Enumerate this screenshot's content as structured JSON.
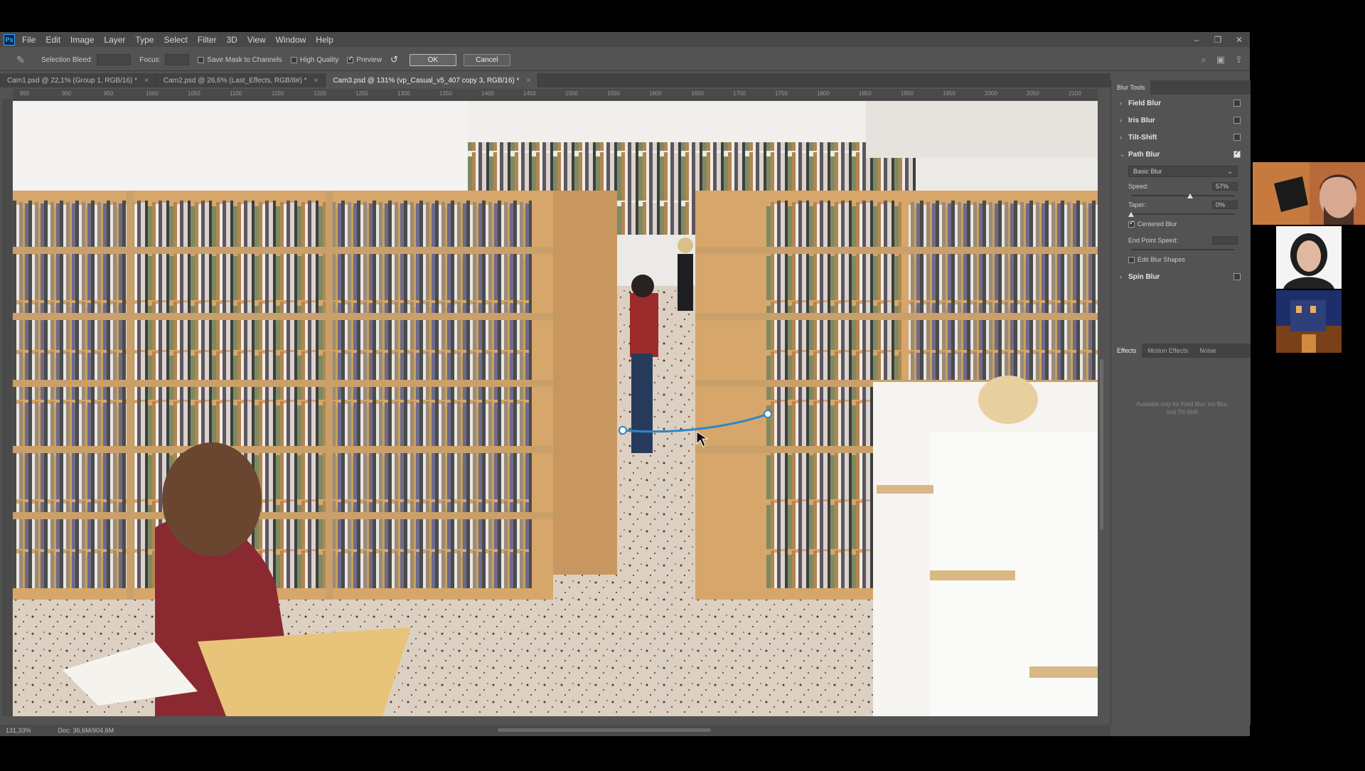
{
  "menu": {
    "logo": "Ps",
    "items": [
      "File",
      "Edit",
      "Image",
      "Layer",
      "Type",
      "Select",
      "Filter",
      "3D",
      "View",
      "Window",
      "Help"
    ]
  },
  "window_controls": [
    "–",
    "❐",
    "✕"
  ],
  "options": {
    "selection_bleed_label": "Selection Bleed:",
    "focus_label": "Focus:",
    "save_mask_label": "Save Mask to Channels",
    "save_mask_checked": false,
    "high_quality_label": "High Quality",
    "high_quality_checked": false,
    "preview_label": "Preview",
    "preview_checked": true,
    "ok_label": "OK",
    "cancel_label": "Cancel"
  },
  "tabs": [
    {
      "label": "Cam1.psd @ 22,1% (Group 1, RGB/16) *",
      "active": false
    },
    {
      "label": "Cam2.psd @ 26,6% (Last_Effects, RGB/8#) *",
      "active": false
    },
    {
      "label": "Cam3.psd @ 131% (vp_Casual_v5_407 copy 3, RGB/16) *",
      "active": true
    }
  ],
  "ruler_ticks": [
    "850",
    "900",
    "950",
    "1000",
    "1050",
    "1100",
    "1150",
    "1200",
    "1250",
    "1300",
    "1350",
    "1400",
    "1450",
    "1500",
    "1550",
    "1600",
    "1650",
    "1700",
    "1750",
    "1800",
    "1850",
    "1900",
    "1950",
    "2000",
    "2050",
    "2100"
  ],
  "status": {
    "zoom": "131,33%",
    "doc": "Doc: 36,6M/904,6M"
  },
  "panel": {
    "title": "Blur Tools",
    "blurs": [
      {
        "label": "Field Blur",
        "checked": false
      },
      {
        "label": "Iris Blur",
        "checked": false
      },
      {
        "label": "Tilt-Shift",
        "checked": false
      },
      {
        "label": "Path Blur",
        "checked": true
      }
    ],
    "path_blur": {
      "mode": "Basic Blur",
      "speed_label": "Speed:",
      "speed_value": "57%",
      "speed_fraction": 0.57,
      "taper_label": "Taper:",
      "taper_value": "0%",
      "taper_fraction": 0.0,
      "centered_blur_label": "Centered Blur",
      "centered_blur_checked": true,
      "end_point_speed_label": "End Point Speed:",
      "edit_blur_shapes_label": "Edit Blur Shapes",
      "edit_blur_shapes_checked": false
    },
    "spin_blur": {
      "label": "Spin Blur",
      "checked": false
    },
    "effects_tabs": [
      "Effects",
      "Motion Effects",
      "Noise"
    ],
    "effects_note": "Available only for Field Blur, Iris Blur, and Tilt-Shift"
  },
  "colors": {
    "path_line": "#2f86c6",
    "shelf_wood": "#d7a86a",
    "floor": "#d8cbbd",
    "ui_bg": "#535353"
  }
}
